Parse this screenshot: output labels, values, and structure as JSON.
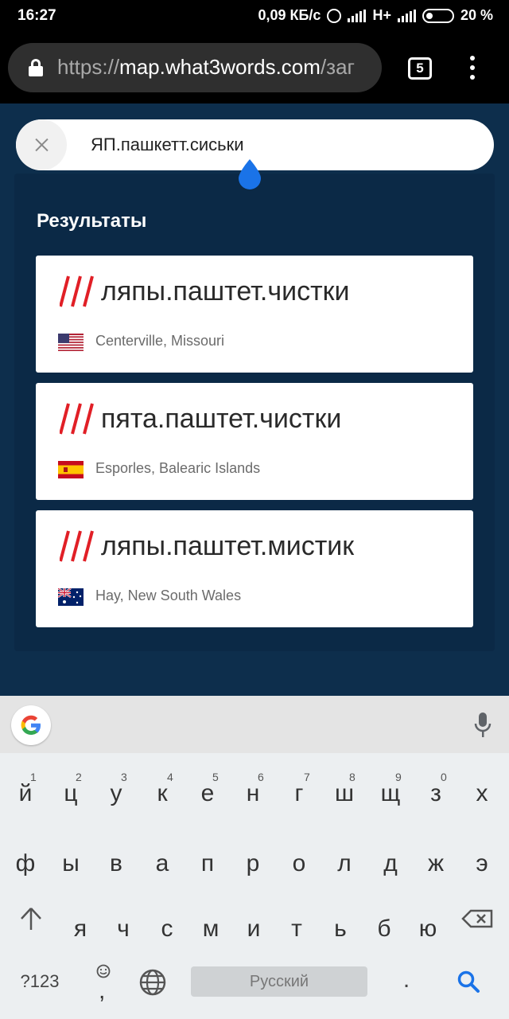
{
  "status_bar": {
    "time": "16:27",
    "speed": "0,09 КБ/с",
    "network": "H+",
    "battery": "20 %"
  },
  "browser": {
    "url_scheme": "https://",
    "url_host": "map.what3words.com",
    "url_path": "/заг",
    "tab_count": "5"
  },
  "search": {
    "value": "ЯП.пашкетт.сиськи"
  },
  "results": {
    "title": "Результаты",
    "items": [
      {
        "words": "ляпы.паштет.чистки",
        "location": "Centerville, Missouri",
        "country": "us"
      },
      {
        "words": "пята.паштет.чистки",
        "location": "Esporles, Balearic Islands",
        "country": "es"
      },
      {
        "words": "ляпы.паштет.мистик",
        "location": "Hay, New South Wales",
        "country": "au"
      }
    ]
  },
  "colors": {
    "brand_red": "#e11f26",
    "map_bg": "#0d2e4c",
    "drop_blue": "#1a73e8"
  },
  "keyboard": {
    "row1": [
      {
        "char": "й",
        "num": "1"
      },
      {
        "char": "ц",
        "num": "2"
      },
      {
        "char": "у",
        "num": "3"
      },
      {
        "char": "к",
        "num": "4"
      },
      {
        "char": "е",
        "num": "5"
      },
      {
        "char": "н",
        "num": "6"
      },
      {
        "char": "г",
        "num": "7"
      },
      {
        "char": "ш",
        "num": "8"
      },
      {
        "char": "щ",
        "num": "9"
      },
      {
        "char": "з",
        "num": "0"
      },
      {
        "char": "х",
        "num": ""
      }
    ],
    "row2": [
      "ф",
      "ы",
      "в",
      "а",
      "п",
      "р",
      "о",
      "л",
      "д",
      "ж",
      "э"
    ],
    "row3": [
      "я",
      "ч",
      "с",
      "м",
      "и",
      "т",
      "ь",
      "б",
      "ю"
    ],
    "symbols_label": "?123",
    "comma_label": ",",
    "space_label": "Русский",
    "period_label": "."
  }
}
